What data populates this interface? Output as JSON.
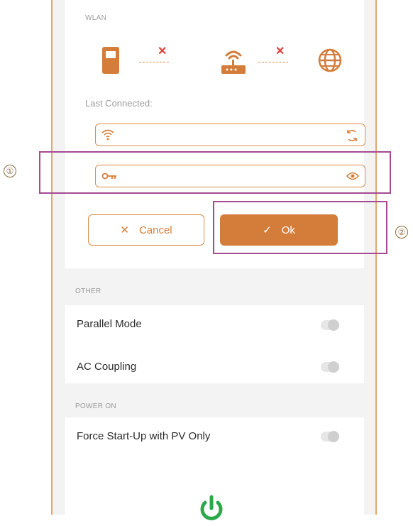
{
  "wlan": {
    "section_label": "WLAN",
    "last_connected_label": "Last Connected:",
    "ssid_value": "",
    "password_value": "",
    "icons": [
      "inverter-icon",
      "router-icon",
      "globe-icon",
      "wifi-icon",
      "refresh-icon",
      "key-icon",
      "eye-icon"
    ],
    "status": [
      "disconnected",
      "disconnected"
    ]
  },
  "buttons": {
    "cancel_label": "Cancel",
    "ok_label": "Ok"
  },
  "other": {
    "section_label": "OTHER",
    "rows": [
      {
        "label": "Parallel Mode",
        "enabled": false
      },
      {
        "label": "AC Coupling",
        "enabled": false
      }
    ]
  },
  "power_on": {
    "section_label": "POWER ON",
    "rows": [
      {
        "label": "Force Start-Up with PV Only",
        "enabled": false
      }
    ]
  },
  "annotations": [
    "①",
    "②"
  ],
  "colors": {
    "accent": "#d47d3a",
    "error": "#e0413a",
    "power": "#2aa84a",
    "annotation": "#a64a93"
  }
}
